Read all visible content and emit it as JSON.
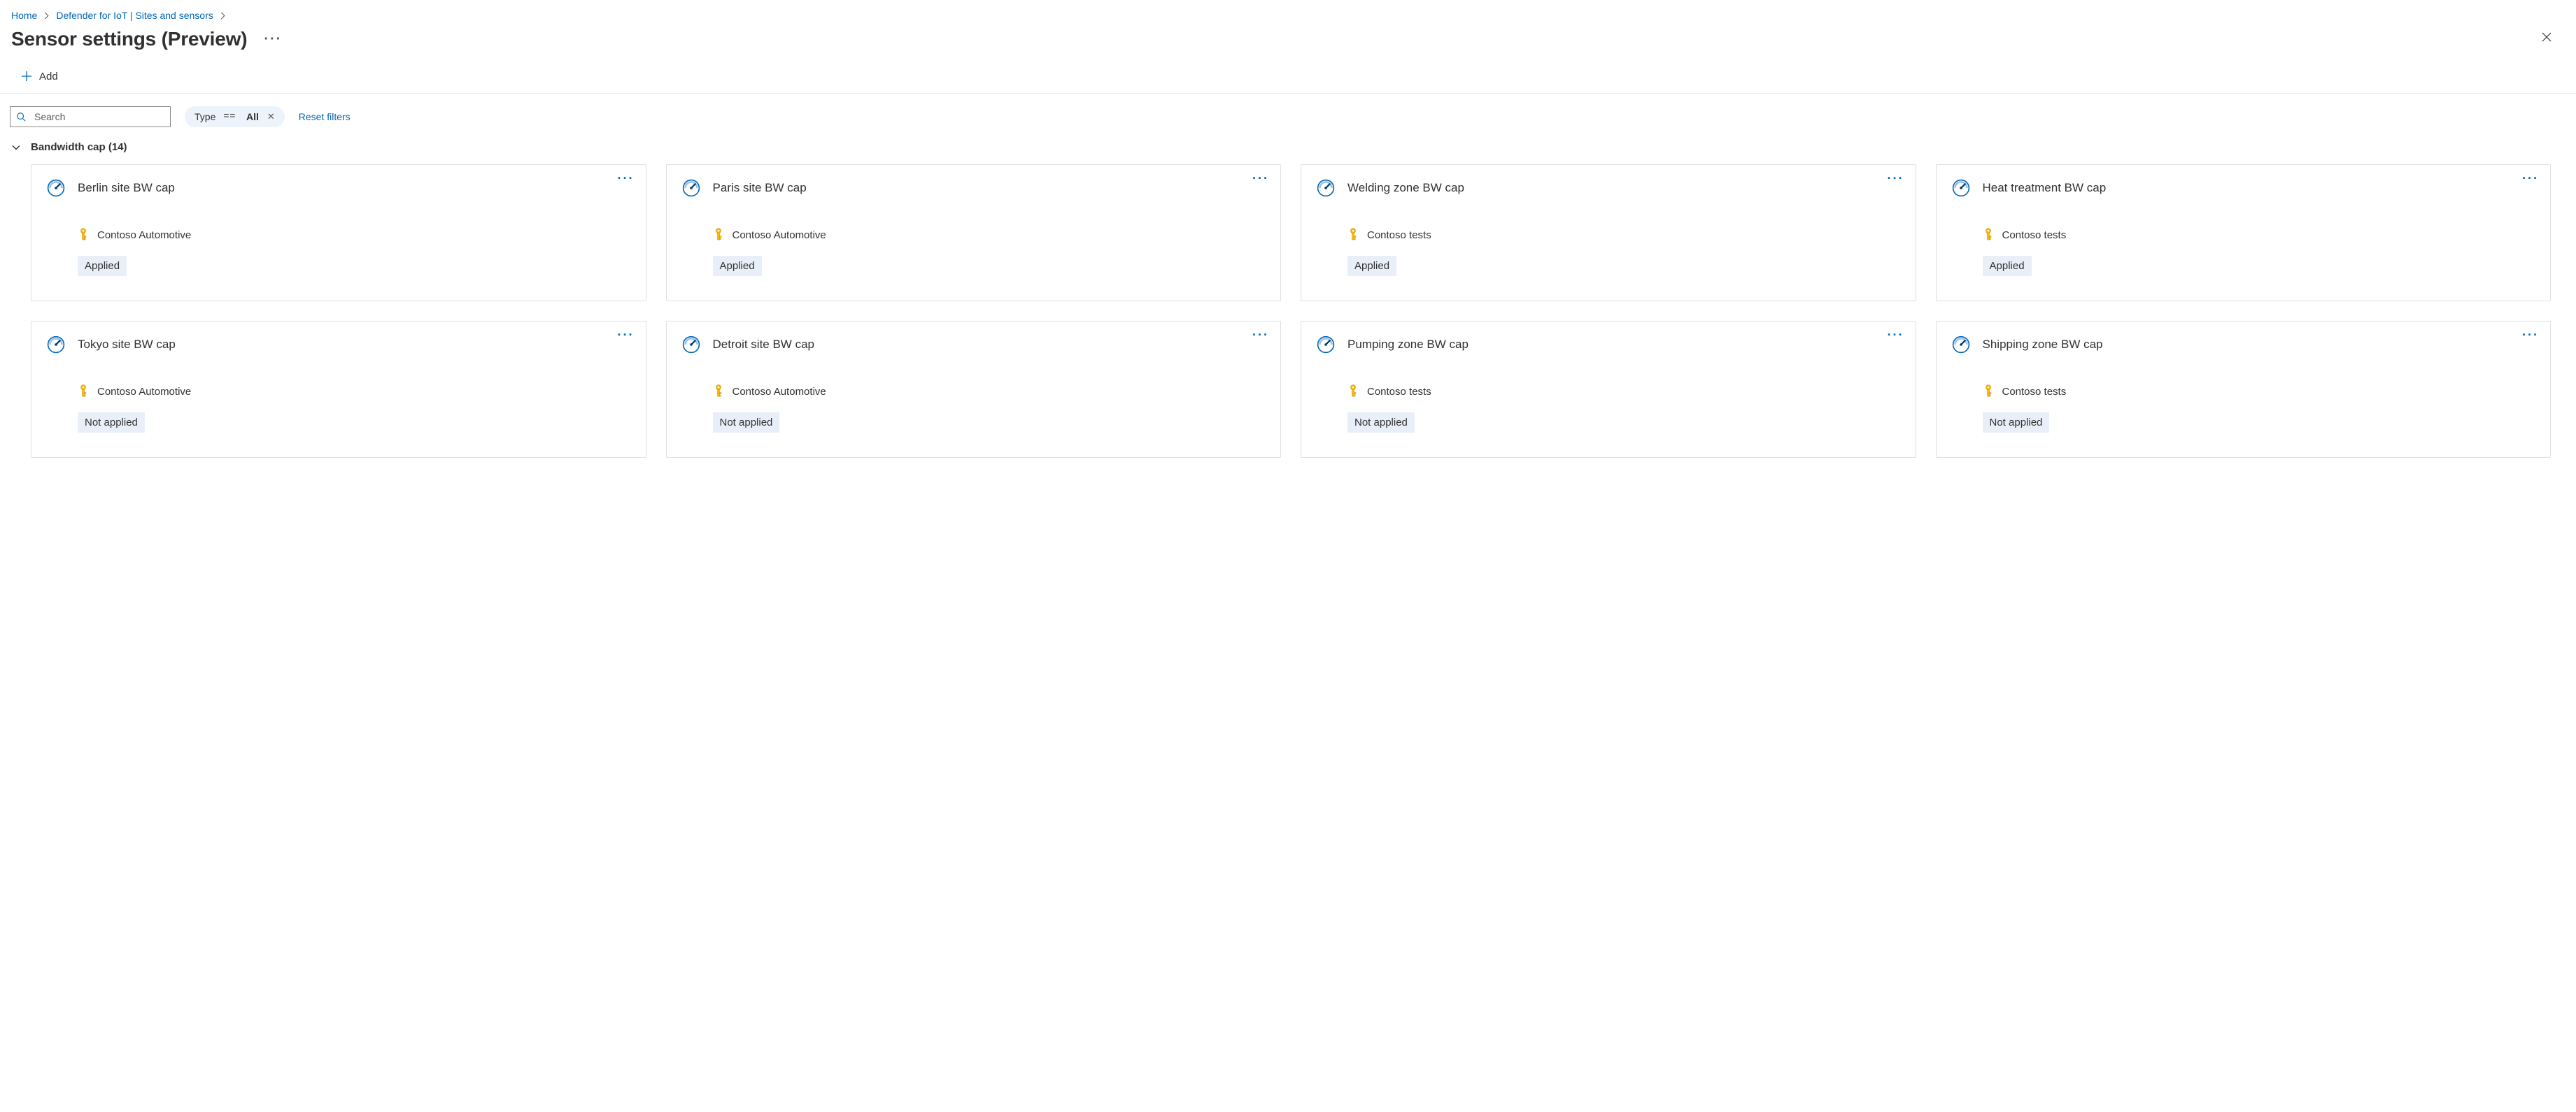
{
  "breadcrumb": {
    "items": [
      "Home",
      "Defender for IoT | Sites and sensors"
    ]
  },
  "page": {
    "title": "Sensor settings (Preview)"
  },
  "commands": {
    "add": "Add"
  },
  "search": {
    "placeholder": "Search",
    "value": ""
  },
  "filter_pill": {
    "label": "Type",
    "op": "==",
    "value": "All"
  },
  "filters": {
    "reset": "Reset filters"
  },
  "group": {
    "label": "Bandwidth cap (14)"
  },
  "cards": [
    {
      "title": "Berlin site BW cap",
      "subscription": "Contoso Automotive",
      "status": "Applied"
    },
    {
      "title": "Paris site BW cap",
      "subscription": "Contoso Automotive",
      "status": "Applied"
    },
    {
      "title": "Welding zone BW cap",
      "subscription": "Contoso tests",
      "status": "Applied"
    },
    {
      "title": "Heat treatment BW cap",
      "subscription": "Contoso tests",
      "status": "Applied"
    },
    {
      "title": "Tokyo site BW cap",
      "subscription": "Contoso Automotive",
      "status": "Not applied"
    },
    {
      "title": "Detroit site BW cap",
      "subscription": "Contoso Automotive",
      "status": "Not applied"
    },
    {
      "title": "Pumping zone BW cap",
      "subscription": "Contoso tests",
      "status": "Not applied"
    },
    {
      "title": "Shipping zone BW cap",
      "subscription": "Contoso tests",
      "status": "Not applied"
    }
  ]
}
